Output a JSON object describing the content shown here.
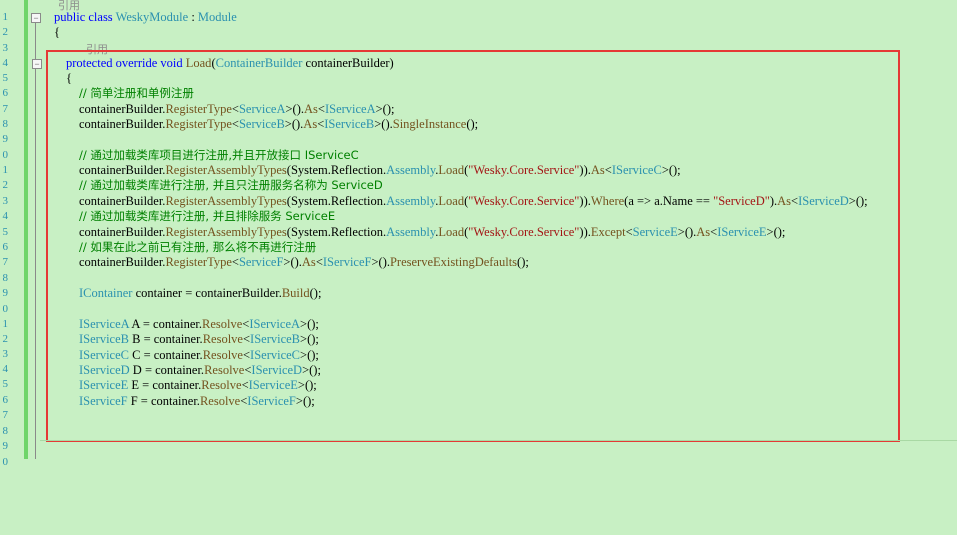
{
  "editor": {
    "line_numbers": [
      "1",
      "2",
      "",
      "3",
      "4",
      "5",
      "6",
      "7",
      "8",
      "9",
      "0",
      "1",
      "2",
      "3",
      "4",
      "5",
      "6",
      "7",
      "8",
      "9",
      "0",
      "1",
      "2",
      "3",
      "4",
      "5",
      "6",
      "7",
      "8",
      "9",
      "0"
    ],
    "ref_label_1": "引用",
    "ref_label_2": "引用",
    "lines": {
      "class_decl_kw": "public class ",
      "class_name": "WeskyModule",
      "class_sep": " : ",
      "class_base": "Module",
      "brace_open_1": "{",
      "method_kw": "protected override void ",
      "method_name": "Load",
      "method_paren": "(",
      "method_param_type": "ContainerBuilder",
      "method_param_rest": " containerBuilder)",
      "brace_open_2": "{",
      "c1": "// 简单注册和单例注册",
      "l1a": "containerBuilder.",
      "l1b": "RegisterType",
      "l1c": "<",
      "l1d": "ServiceA",
      "l1e": ">().",
      "l1f": "As",
      "l1g": "<",
      "l1h": "IServiceA",
      "l1i": ">();",
      "l2a": "containerBuilder.",
      "l2b": "RegisterType",
      "l2c": "<",
      "l2d": "ServiceB",
      "l2e": ">().",
      "l2f": "As",
      "l2g": "<",
      "l2h": "IServiceB",
      "l2i": ">().",
      "l2j": "SingleInstance",
      "l2k": "();",
      "c2": "// 通过加载类库项目进行注册,并且开放接口 IServiceC",
      "l3a": "containerBuilder.",
      "l3b": "RegisterAssemblyTypes",
      "l3c": "(System.Reflection.",
      "l3d": "Assembly",
      "l3e": ".",
      "l3f": "Load",
      "l3g": "(",
      "l3h": "\"Wesky.Core.Service\"",
      "l3i": ")).",
      "l3j": "As",
      "l3k": "<",
      "l3l": "IServiceC",
      "l3m": ">();",
      "c3": "// 通过加载类库进行注册, 并且只注册服务名称为 ServiceD",
      "l4a": "containerBuilder.",
      "l4b": "RegisterAssemblyTypes",
      "l4c": "(System.Reflection.",
      "l4d": "Assembly",
      "l4e": ".",
      "l4f": "Load",
      "l4g": "(",
      "l4h": "\"Wesky.Core.Service\"",
      "l4i": ")).",
      "l4j": "Where",
      "l4k": "(a => a.Name == ",
      "l4l": "\"ServiceD\"",
      "l4m": ").",
      "l4n": "As",
      "l4o": "<",
      "l4p": "IServiceD",
      "l4q": ">();",
      "c4": "// 通过加载类库进行注册, 并且排除服务 ServiceE",
      "l5a": "containerBuilder.",
      "l5b": "RegisterAssemblyTypes",
      "l5c": "(System.Reflection.",
      "l5d": "Assembly",
      "l5e": ".",
      "l5f": "Load",
      "l5g": "(",
      "l5h": "\"Wesky.Core.Service\"",
      "l5i": ")).",
      "l5j": "Except",
      "l5k": "<",
      "l5l": "ServiceE",
      "l5m": ">().",
      "l5n": "As",
      "l5o": "<",
      "l5p": "IServiceE",
      "l5q": ">();",
      "c5": "// 如果在此之前已有注册, 那么将不再进行注册",
      "l6a": "containerBuilder.",
      "l6b": "RegisterType",
      "l6c": "<",
      "l6d": "ServiceF",
      "l6e": ">().",
      "l6f": "As",
      "l6g": "<",
      "l6h": "IServiceF",
      "l6i": ">().",
      "l6j": "PreserveExistingDefaults",
      "l6k": "();",
      "l7a": "IContainer",
      "l7b": " container = containerBuilder.",
      "l7c": "Build",
      "l7d": "();",
      "r": [
        {
          "type": "IServiceA",
          "var": " A = container.",
          "m": "Resolve",
          "t": "IServiceA"
        },
        {
          "type": "IServiceB",
          "var": " B = container.",
          "m": "Resolve",
          "t": "IServiceB"
        },
        {
          "type": "IServiceC",
          "var": " C = container.",
          "m": "Resolve",
          "t": "IServiceC"
        },
        {
          "type": "IServiceD",
          "var": " D = container.",
          "m": "Resolve",
          "t": "IServiceD"
        },
        {
          "type": "IServiceE",
          "var": " E = container.",
          "m": "Resolve",
          "t": "IServiceE"
        },
        {
          "type": "IServiceF",
          "var": " F = container.",
          "m": "Resolve",
          "t": "IServiceF"
        }
      ],
      "lt": "<",
      "end": ">();"
    }
  },
  "colors": {
    "background": "#c8f0c4",
    "keyword": "#0000ff",
    "type": "#2b91af",
    "comment": "#008000",
    "string": "#a31515",
    "method": "#74531f",
    "highlight_box": "#e53935"
  }
}
